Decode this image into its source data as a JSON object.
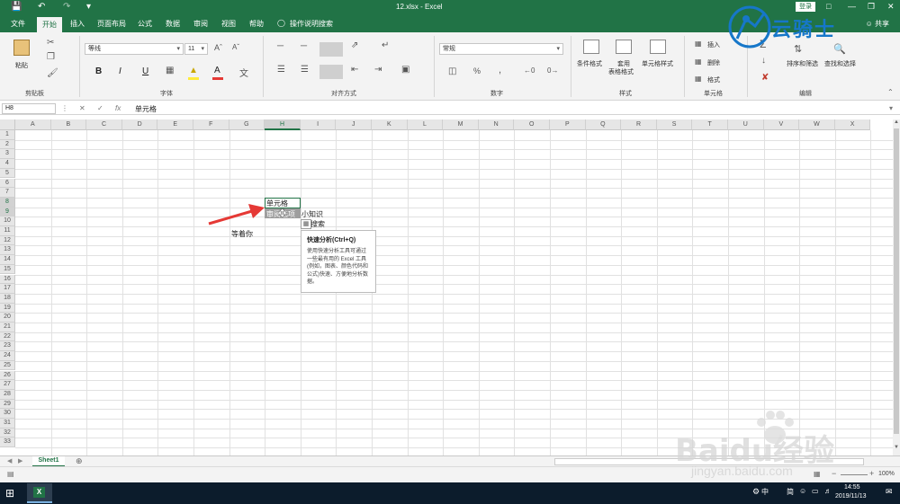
{
  "titlebar": {
    "title": "12.xlsx - Excel",
    "login_label": "登录",
    "icons": [
      "save-icon",
      "undo-icon",
      "redo-icon",
      "customize-icon"
    ]
  },
  "tabs": [
    "文件",
    "开始",
    "插入",
    "页面布局",
    "公式",
    "数据",
    "审阅",
    "视图",
    "帮助"
  ],
  "active_tab": "开始",
  "tell_me": "操作说明搜索",
  "share_label": "共享",
  "ribbon": {
    "clipboard": {
      "label": "剪贴板",
      "paste_label": "粘贴"
    },
    "font": {
      "label": "字体",
      "font_name": "等线",
      "font_size": "11",
      "bold": "B",
      "italic": "I",
      "underline": "U"
    },
    "alignment": {
      "label": "对齐方式"
    },
    "number": {
      "label": "数字",
      "format": "常规",
      "percent": "%",
      "comma": ","
    },
    "styles": {
      "label": "样式",
      "conditional_format": "条件格式",
      "format_as_table_l1": "套用",
      "format_as_table_l2": "表格格式",
      "cell_styles": "单元格样式"
    },
    "cells": {
      "label": "单元格",
      "insert": "插入",
      "delete": "删除",
      "format": "格式"
    },
    "editing": {
      "label": "编辑",
      "sort_filter": "排序和筛选",
      "find_select": "查找和选择"
    }
  },
  "formula_bar": {
    "name_box": "H8",
    "fx_label": "fx",
    "value": "单元格"
  },
  "grid": {
    "columns": [
      "A",
      "B",
      "C",
      "D",
      "E",
      "F",
      "G",
      "H",
      "I",
      "J",
      "K",
      "L",
      "M",
      "N",
      "O",
      "P",
      "Q",
      "R",
      "S",
      "T",
      "U",
      "V",
      "W",
      "X"
    ],
    "rows": [
      "1",
      "2",
      "3",
      "4",
      "5",
      "6",
      "7",
      "8",
      "9",
      "10",
      "11",
      "12",
      "13",
      "14",
      "15",
      "16",
      "17",
      "18",
      "19",
      "20",
      "21",
      "22",
      "23",
      "24",
      "25",
      "26",
      "27",
      "28",
      "29",
      "30",
      "31",
      "32",
      "33"
    ],
    "selected_column": "H",
    "selected_rows": [
      "8",
      "9"
    ],
    "cells": {
      "h8": "单元格",
      "h9": "审阅选项",
      "i9": "小知识",
      "i10": "搜索",
      "g11": "等着你"
    }
  },
  "tooltip": {
    "title": "快速分析(Ctrl+Q)",
    "body": "使用快速分析工具可通过一些最有用的 Excel 工具(例如，图表、颜色代码和公式)快速、方便地分析数据。"
  },
  "sheet_tabs": [
    "Sheet1"
  ],
  "status": {
    "zoom": "100%"
  },
  "taskbar": {
    "time": "14:55",
    "date": "2019/11/13",
    "ime": "中",
    "ime2": "简"
  },
  "watermarks": {
    "logo_text": "云骑士",
    "baidu_text": "Baidu经验",
    "baidu_url": "jingyan.baidu.com"
  },
  "colors": {
    "excel_green": "#217346",
    "arrow_red": "#e53935",
    "watermark_blue": "#1677c9"
  }
}
